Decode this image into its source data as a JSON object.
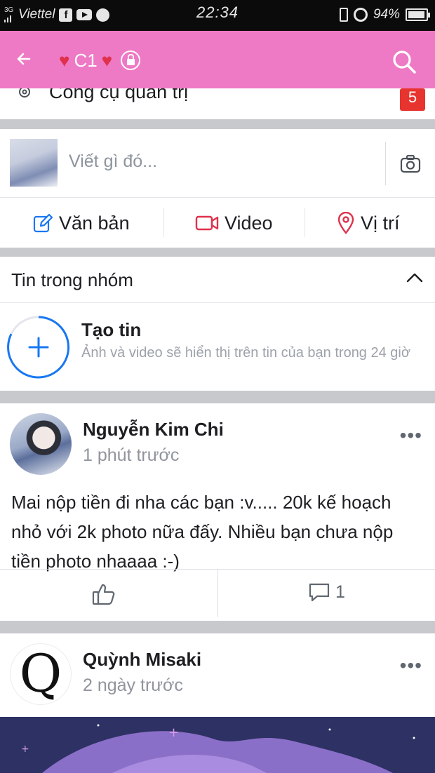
{
  "status_bar": {
    "network": "3G",
    "carrier": "Viettel",
    "time": "22:34",
    "battery": "94%",
    "battery_level": 0.94,
    "icons": [
      "signal-icon",
      "facebook-icon",
      "youtube-icon",
      "messenger-icon",
      "vibrate-icon",
      "alarm-icon",
      "battery-icon"
    ]
  },
  "app_bar": {
    "title": "C1",
    "background": "#ee79c5",
    "heart_color": "#e0314b",
    "back_icon": "back-arrow-icon",
    "privacy_icon": "lock-icon",
    "search_icon": "search-icon"
  },
  "admin_tools": {
    "label": "Công cụ quản trị",
    "badge": "5",
    "badge_color": "#e8342f",
    "icon": "gear-icon"
  },
  "composer": {
    "placeholder": "Viết gì đó...",
    "camera_icon": "camera-icon"
  },
  "composer_actions": [
    {
      "label": "Văn bản",
      "icon": "edit-icon",
      "color": "#1877f2"
    },
    {
      "label": "Video",
      "icon": "video-icon",
      "color": "#e0314b"
    },
    {
      "label": "Vị trí",
      "icon": "location-pin-icon",
      "color": "#e0314b"
    }
  ],
  "stories": {
    "title": "Tin trong nhóm",
    "create_title": "Tạo tin",
    "create_subtitle": "Ảnh và video sẽ hiển thị trên tin của bạn trong 24 giờ",
    "accent": "#1877f2"
  },
  "posts": [
    {
      "author": "Nguyễn Kim Chi",
      "time": "1 phút trước",
      "text": "Mai nộp tiền đi nha các bạn :v..... 20k kế hoạch nhỏ với 2k photo nữa đấy. Nhiều bạn chưa nộp tiền photo nhaaaa :-)",
      "comment_count": "1",
      "more": "•••"
    },
    {
      "author": "Quỳnh Misaki",
      "time": "2 ngày trước",
      "avatar_letter": "Q",
      "more": "•••"
    }
  ]
}
